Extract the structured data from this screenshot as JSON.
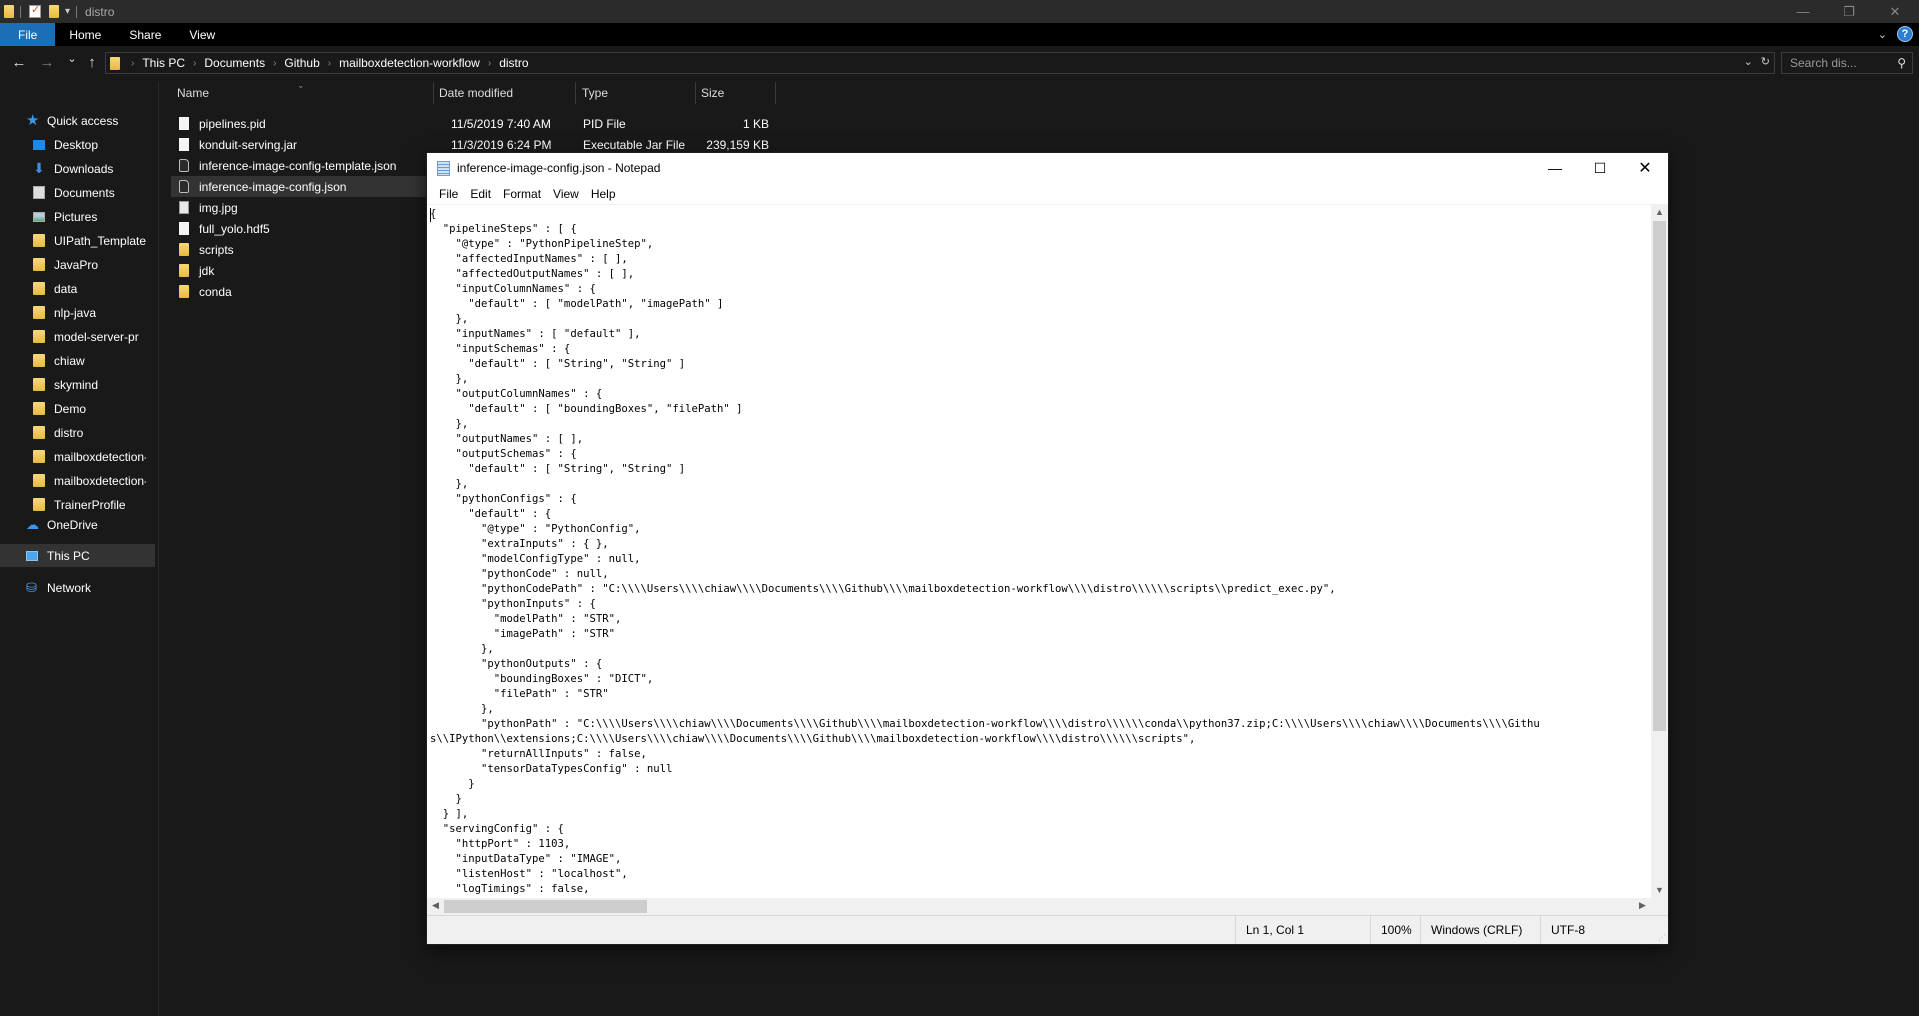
{
  "explorer": {
    "window_title": "distro",
    "title_controls": {
      "minimize": "—",
      "restore": "❐",
      "close": "✕"
    },
    "ribbon_tabs": [
      "File",
      "Home",
      "Share",
      "View"
    ],
    "nav_buttons": {
      "back": "←",
      "forward": "→",
      "recent": "⌄",
      "up": "↑"
    },
    "breadcrumb": [
      "This PC",
      "Documents",
      "Github",
      "mailboxdetection-workflow",
      "distro"
    ],
    "search_placeholder": "Search dis...",
    "nav_pane": {
      "quick_access_label": "Quick access",
      "items": [
        {
          "label": "Desktop",
          "icon": "desktop-icon",
          "pinned": true
        },
        {
          "label": "Downloads",
          "icon": "downloads-icon",
          "pinned": true
        },
        {
          "label": "Documents",
          "icon": "documents-icon",
          "pinned": true
        },
        {
          "label": "Pictures",
          "icon": "pictures-icon",
          "pinned": true
        },
        {
          "label": "UIPath_Template",
          "icon": "folder-icon",
          "pinned": true
        },
        {
          "label": "JavaPro",
          "icon": "folder-icon",
          "pinned": true
        },
        {
          "label": "data",
          "icon": "folder-icon",
          "pinned": true
        },
        {
          "label": "nlp-java",
          "icon": "folder-icon",
          "pinned": true
        },
        {
          "label": "model-server-pr",
          "icon": "folder-icon",
          "pinned": true
        },
        {
          "label": "chiaw",
          "icon": "folder-icon",
          "pinned": true
        },
        {
          "label": "skymind",
          "icon": "folder-icon",
          "pinned": true
        },
        {
          "label": "Demo",
          "icon": "folder-icon",
          "pinned": true
        },
        {
          "label": "distro",
          "icon": "folder-icon",
          "pinned": false
        },
        {
          "label": "mailboxdetection-v",
          "icon": "folder-icon",
          "pinned": false
        },
        {
          "label": "mailboxdetection-v",
          "icon": "folder-icon",
          "pinned": false
        },
        {
          "label": "TrainerProfile",
          "icon": "folder-icon",
          "pinned": false
        }
      ],
      "onedrive_label": "OneDrive",
      "thispc_label": "This PC",
      "network_label": "Network"
    },
    "columns": [
      "Name",
      "Date modified",
      "Type",
      "Size"
    ],
    "files": [
      {
        "name": "pipelines.pid",
        "date": "11/5/2019 7:40 AM",
        "type": "PID File",
        "size": "1 KB",
        "kind": "file"
      },
      {
        "name": "konduit-serving.jar",
        "date": "11/3/2019 6:24 PM",
        "type": "Executable Jar File",
        "size": "239,159 KB",
        "kind": "file"
      },
      {
        "name": "inference-image-config-template.json",
        "date": "",
        "type": "",
        "size": "",
        "kind": "json"
      },
      {
        "name": "inference-image-config.json",
        "date": "",
        "type": "",
        "size": "",
        "kind": "json",
        "selected": true
      },
      {
        "name": "img.jpg",
        "date": "",
        "type": "",
        "size": "",
        "kind": "image"
      },
      {
        "name": "full_yolo.hdf5",
        "date": "",
        "type": "",
        "size": "",
        "kind": "file"
      },
      {
        "name": "scripts",
        "date": "",
        "type": "",
        "size": "",
        "kind": "folder"
      },
      {
        "name": "jdk",
        "date": "",
        "type": "",
        "size": "",
        "kind": "folder"
      },
      {
        "name": "conda",
        "date": "",
        "type": "",
        "size": "",
        "kind": "folder"
      }
    ]
  },
  "notepad": {
    "title": "inference-image-config.json - Notepad",
    "menu": [
      "File",
      "Edit",
      "Format",
      "View",
      "Help"
    ],
    "content": "{\n  \"pipelineSteps\" : [ {\n    \"@type\" : \"PythonPipelineStep\",\n    \"affectedInputNames\" : [ ],\n    \"affectedOutputNames\" : [ ],\n    \"inputColumnNames\" : {\n      \"default\" : [ \"modelPath\", \"imagePath\" ]\n    },\n    \"inputNames\" : [ \"default\" ],\n    \"inputSchemas\" : {\n      \"default\" : [ \"String\", \"String\" ]\n    },\n    \"outputColumnNames\" : {\n      \"default\" : [ \"boundingBoxes\", \"filePath\" ]\n    },\n    \"outputNames\" : [ ],\n    \"outputSchemas\" : {\n      \"default\" : [ \"String\", \"String\" ]\n    },\n    \"pythonConfigs\" : {\n      \"default\" : {\n        \"@type\" : \"PythonConfig\",\n        \"extraInputs\" : { },\n        \"modelConfigType\" : null,\n        \"pythonCode\" : null,\n        \"pythonCodePath\" : \"C:\\\\\\\\Users\\\\\\\\chiaw\\\\\\\\Documents\\\\\\\\Github\\\\\\\\mailboxdetection-workflow\\\\\\\\distro\\\\\\\\\\\\scripts\\\\predict_exec.py\",\n        \"pythonInputs\" : {\n          \"modelPath\" : \"STR\",\n          \"imagePath\" : \"STR\"\n        },\n        \"pythonOutputs\" : {\n          \"boundingBoxes\" : \"DICT\",\n          \"filePath\" : \"STR\"\n        },\n        \"pythonPath\" : \"C:\\\\\\\\Users\\\\\\\\chiaw\\\\\\\\Documents\\\\\\\\Github\\\\\\\\mailboxdetection-workflow\\\\\\\\distro\\\\\\\\\\\\conda\\\\python37.zip;C:\\\\\\\\Users\\\\\\\\chiaw\\\\\\\\Documents\\\\\\\\Githu\ns\\\\IPython\\\\extensions;C:\\\\\\\\Users\\\\\\\\chiaw\\\\\\\\Documents\\\\\\\\Github\\\\\\\\mailboxdetection-workflow\\\\\\\\distro\\\\\\\\\\\\scripts\",\n        \"returnAllInputs\" : false,\n        \"tensorDataTypesConfig\" : null\n      }\n    }\n  } ],\n  \"servingConfig\" : {\n    \"httpPort\" : 1103,\n    \"inputDataType\" : \"IMAGE\",\n    \"listenHost\" : \"localhost\",\n    \"logTimings\" : false,\n    \"outputDataType\" : \"JSON\"",
    "status": {
      "position": "Ln 1, Col 1",
      "zoom": "100%",
      "line_ending": "Windows (CRLF)",
      "encoding": "UTF-8"
    }
  }
}
